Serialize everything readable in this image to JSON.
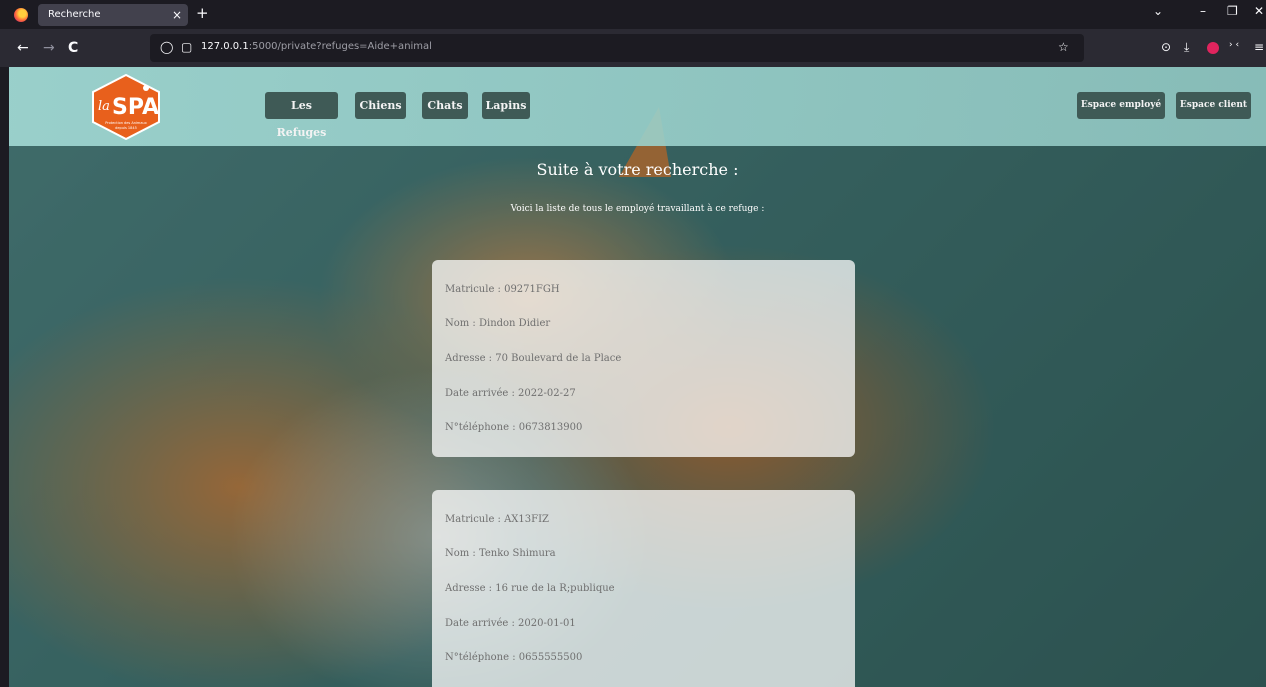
{
  "browser": {
    "tab_title": "Recherche",
    "tab_close": "×",
    "new_tab": "+",
    "url_host": "127.0.0.1",
    "url_rest": ":5000/private?refuges=Aide+animal",
    "back_icon": "←",
    "forward_icon": "→",
    "reload_icon": "C",
    "shield_icon": "◯",
    "page_icon": "▢",
    "bookmark_icon": "☆",
    "pocket_icon": "⊙",
    "download_icon": "⤓",
    "ext_icon": "› ‹",
    "menu_icon": "≡",
    "tabs_list_icon": "⌄",
    "minimize_icon": "–",
    "maximize_icon": "❐",
    "close_icon": "✕"
  },
  "header": {
    "logo_text": "laSPA",
    "logo_caption": "Protection des Animaux depuis 1845",
    "nav": [
      "Les Refuges",
      "Chiens",
      "Chats",
      "Lapins"
    ],
    "employee_space": "Espace employé",
    "client_space": "Espace client"
  },
  "main": {
    "title": "Suite à votre recherche :",
    "subtitle": "Voici la liste de tous le employé travaillant à ce refuge :",
    "employees": [
      {
        "matricule": "Matricule : 09271FGH",
        "nom": "Nom : Dindon Didier",
        "adresse": "Adresse : 70 Boulevard de la Place",
        "date": "Date arrivée : 2022-02-27",
        "telephone": "N°téléphone : 0673813900"
      },
      {
        "matricule": "Matricule : AX13FIZ",
        "nom": "Nom : Tenko Shimura",
        "adresse": "Adresse : 16 rue de la R;publique",
        "date": "Date arrivée : 2020-01-01",
        "telephone": "N°téléphone : 0655555500"
      }
    ]
  },
  "colors": {
    "nav_button": "#3f5a56",
    "header_bg": "#a0d7d2",
    "logo_orange": "#e8601c",
    "card_bg": "#ffffff"
  }
}
